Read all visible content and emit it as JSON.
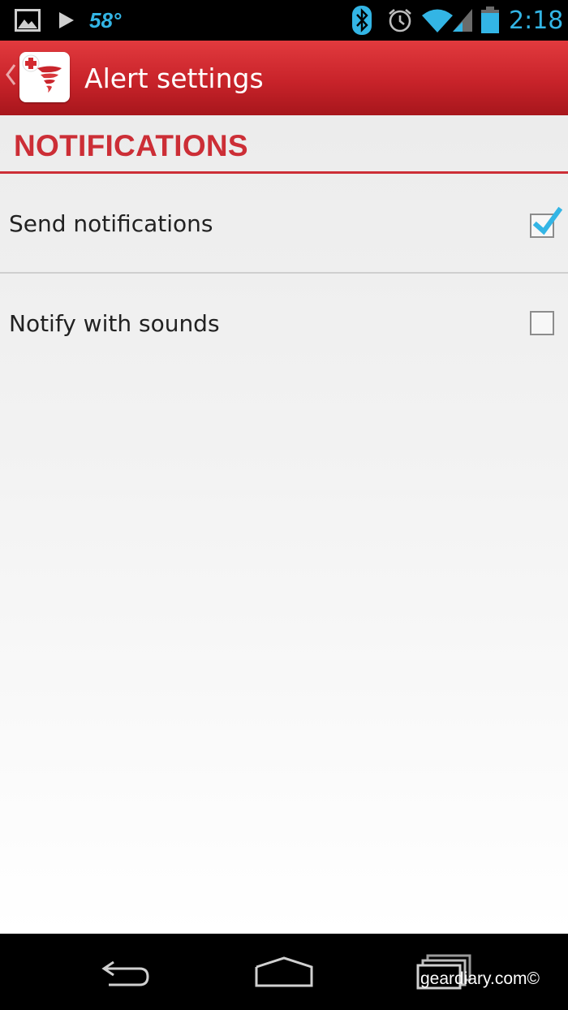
{
  "status_bar": {
    "temperature": "58°",
    "time": "2:18",
    "icons": [
      "image-notification-icon",
      "play-store-icon",
      "bluetooth-icon",
      "alarm-icon",
      "wifi-icon",
      "signal-icon",
      "battery-icon"
    ],
    "accent_color": "#33b5e5"
  },
  "action_bar": {
    "title": "Alert settings",
    "app_icon": "tornado-app-icon",
    "background_color": "#c8232a"
  },
  "settings": {
    "section_title": "NOTIFICATIONS",
    "section_color": "#cc2e36",
    "items": [
      {
        "label": "Send notifications",
        "checked": true
      },
      {
        "label": "Notify with sounds",
        "checked": false
      }
    ]
  },
  "nav_bar": {
    "buttons": [
      "back-nav-icon",
      "home-nav-icon",
      "recent-apps-icon"
    ]
  },
  "watermark": "geardiary.com©"
}
